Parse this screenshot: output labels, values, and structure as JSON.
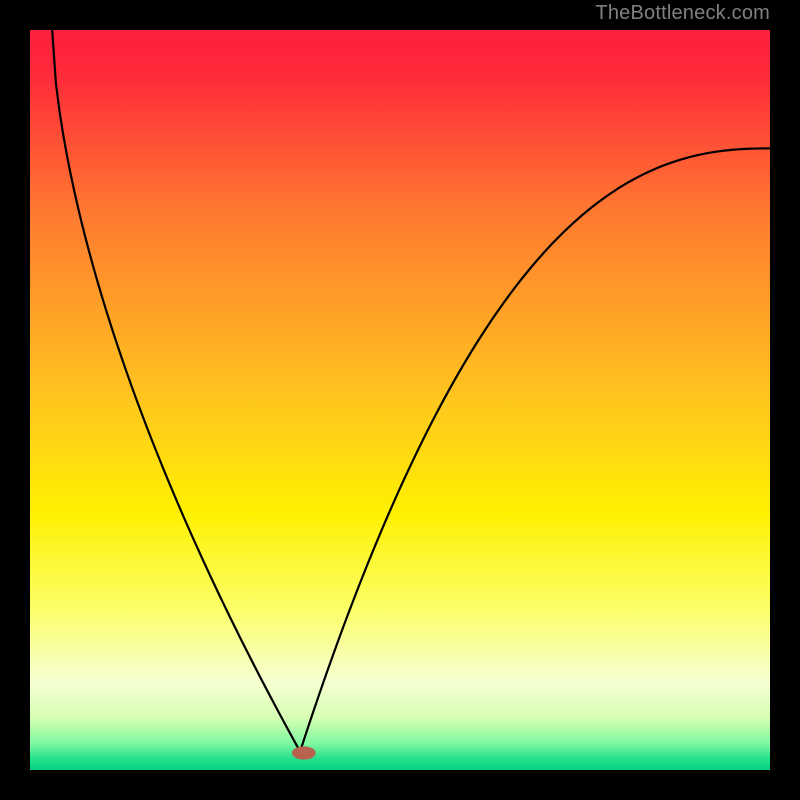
{
  "watermark": "TheBottleneck.com",
  "chart_data": {
    "type": "line",
    "title": "",
    "xlabel": "",
    "ylabel": "",
    "xlim": [
      0,
      100
    ],
    "ylim": [
      0,
      100
    ],
    "gradient_stops": [
      {
        "offset": 0.0,
        "color": "#ff1e3c"
      },
      {
        "offset": 0.06,
        "color": "#ff2a3a"
      },
      {
        "offset": 0.25,
        "color": "#ff7a30"
      },
      {
        "offset": 0.5,
        "color": "#ffc61e"
      },
      {
        "offset": 0.65,
        "color": "#fff000"
      },
      {
        "offset": 0.78,
        "color": "#fbff66"
      },
      {
        "offset": 0.88,
        "color": "#f6ffd2"
      },
      {
        "offset": 0.93,
        "color": "#d6ffb3"
      },
      {
        "offset": 0.965,
        "color": "#7cf7a0"
      },
      {
        "offset": 0.985,
        "color": "#22e08a"
      },
      {
        "offset": 1.0,
        "color": "#06d186"
      }
    ],
    "curve": {
      "min_x": 36.5,
      "min_y": 97.5,
      "left_start": {
        "x": 3,
        "y": 0
      },
      "right_end": {
        "x": 100,
        "y": 16
      },
      "description": "V-shaped bottleneck curve touching baseline near x≈36"
    },
    "marker": {
      "x": 37,
      "y": 97.7,
      "rx": 1.6,
      "ry": 0.9,
      "color": "#b8614f"
    }
  }
}
